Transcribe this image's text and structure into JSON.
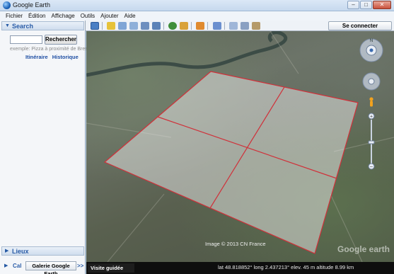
{
  "window": {
    "title": "Google Earth",
    "min": "–",
    "max": "□",
    "close": "✕"
  },
  "menu": [
    "Fichier",
    "Édition",
    "Affichage",
    "Outils",
    "Ajouter",
    "Aide"
  ],
  "search": {
    "header": "Search",
    "button": "Rechercher",
    "hint": "exemple: Pizza à proximité de Bres",
    "links": [
      "Itinéraire",
      "Historique"
    ]
  },
  "places": {
    "header": "Lieux"
  },
  "gallery": {
    "short_label": "Cal",
    "button": "Galerie Google Earth",
    "more": ">>"
  },
  "toolbar": {
    "signin": "Se connecter"
  },
  "map": {
    "copyright": "Image © 2013 CN France",
    "logo": "Google earth",
    "tour_button": "Visite guidée",
    "status": "lat  48.818852°  long  2.437213°  elev.  45 m    altitude  8.99 km"
  }
}
